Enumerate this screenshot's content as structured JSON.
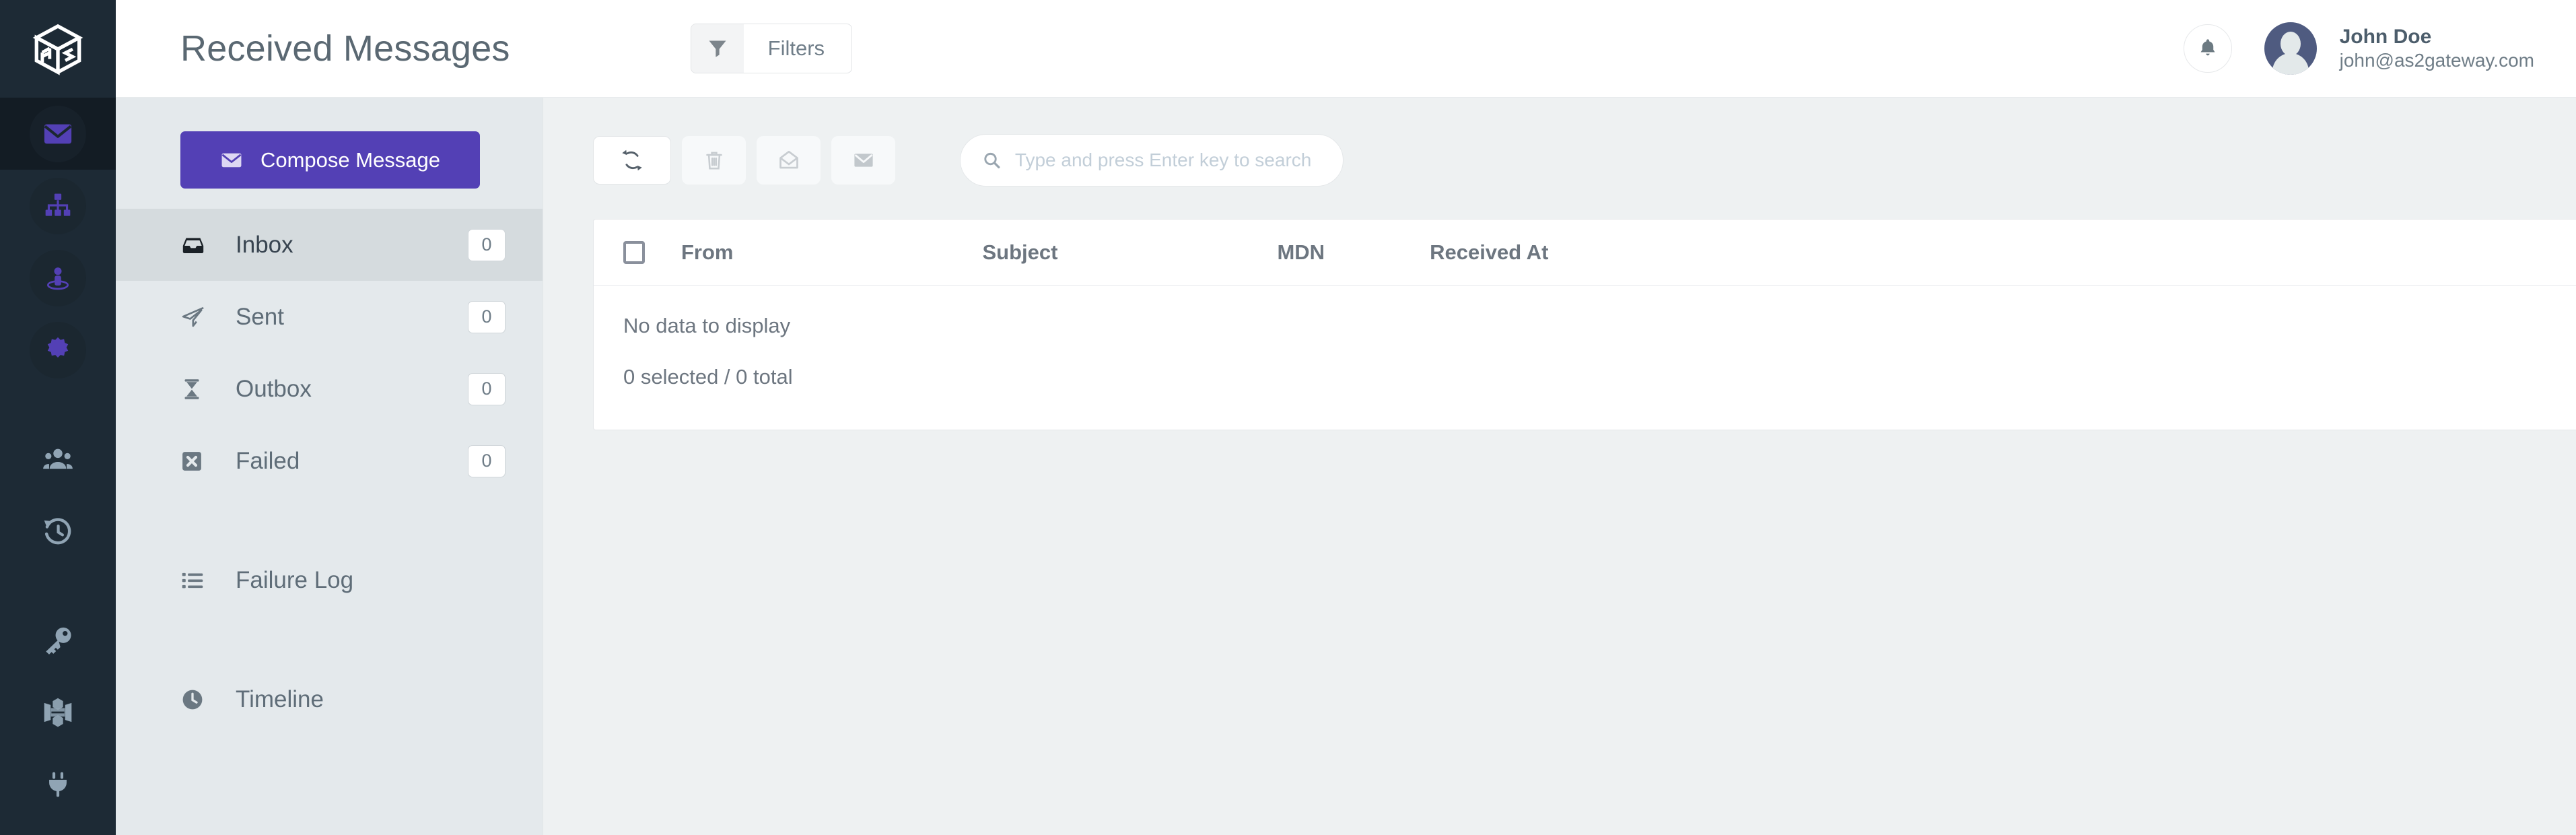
{
  "header": {
    "title": "Received Messages",
    "filters_label": "Filters",
    "filter_icon": "funnel-icon",
    "bell_icon": "bell-icon",
    "user": {
      "name": "John Doe",
      "email": "john@as2gateway.com"
    }
  },
  "rail": {
    "logo_icon": "as2-cube-logo",
    "items": [
      {
        "icon": "envelope-icon",
        "name": "messages",
        "active": true,
        "accent": "#5340b5"
      },
      {
        "icon": "sitemap-icon",
        "name": "partners",
        "active": false,
        "accent": "#5340b5"
      },
      {
        "icon": "user-location-icon",
        "name": "stations",
        "active": false,
        "accent": "#5340b5"
      },
      {
        "icon": "certificate-icon",
        "name": "certificates",
        "active": false,
        "accent": "#5340b5"
      },
      {
        "icon": "users-icon",
        "name": "users",
        "active": false,
        "accent": "#90a4b4"
      },
      {
        "icon": "history-icon",
        "name": "history",
        "active": false,
        "accent": "#90a4b4"
      },
      {
        "icon": "key-icon",
        "name": "keys",
        "active": false,
        "accent": "#90a4b4"
      },
      {
        "icon": "aws-cube-icon",
        "name": "storage",
        "active": false,
        "accent": "#90a4b4"
      },
      {
        "icon": "plug-icon",
        "name": "connectors",
        "active": false,
        "accent": "#90a4b4"
      }
    ]
  },
  "folders": {
    "compose_label": "Compose Message",
    "compose_icon": "envelope-icon",
    "items": [
      {
        "label": "Inbox",
        "count": "0",
        "icon": "inbox-icon",
        "active": true
      },
      {
        "label": "Sent",
        "count": "0",
        "icon": "paper-plane-icon",
        "active": false
      },
      {
        "label": "Outbox",
        "count": "0",
        "icon": "hourglass-icon",
        "active": false
      },
      {
        "label": "Failed",
        "count": "0",
        "icon": "x-square-icon",
        "active": false
      }
    ],
    "links": [
      {
        "label": "Failure Log",
        "icon": "list-icon"
      },
      {
        "label": "Timeline",
        "icon": "clock-icon"
      }
    ]
  },
  "toolbar": {
    "buttons": [
      {
        "name": "refresh",
        "icon": "refresh-icon",
        "style": "primary"
      },
      {
        "name": "delete",
        "icon": "trash-icon",
        "style": "ghost"
      },
      {
        "name": "mark-as-read",
        "icon": "envelope-open-icon",
        "style": "ghost"
      },
      {
        "name": "mark-as-unread",
        "icon": "envelope-icon",
        "style": "ghost"
      }
    ],
    "search": {
      "icon": "search-icon",
      "placeholder": "Type and press Enter key to search",
      "value": ""
    }
  },
  "table": {
    "select_all_icon": "checkbox-icon",
    "columns": [
      "From",
      "Subject",
      "MDN",
      "Received At"
    ],
    "rows": [],
    "empty_text": "No data to display",
    "status_text": "0 selected / 0 total"
  },
  "colors": {
    "accent": "#5340b5",
    "rail_bg": "#1d2a35",
    "rail_active_bg": "#131c24",
    "folder_bg": "#e4e9ec",
    "folder_active_bg": "#d5dbde",
    "content_bg": "#eef1f2",
    "text_muted": "#6d7680"
  }
}
